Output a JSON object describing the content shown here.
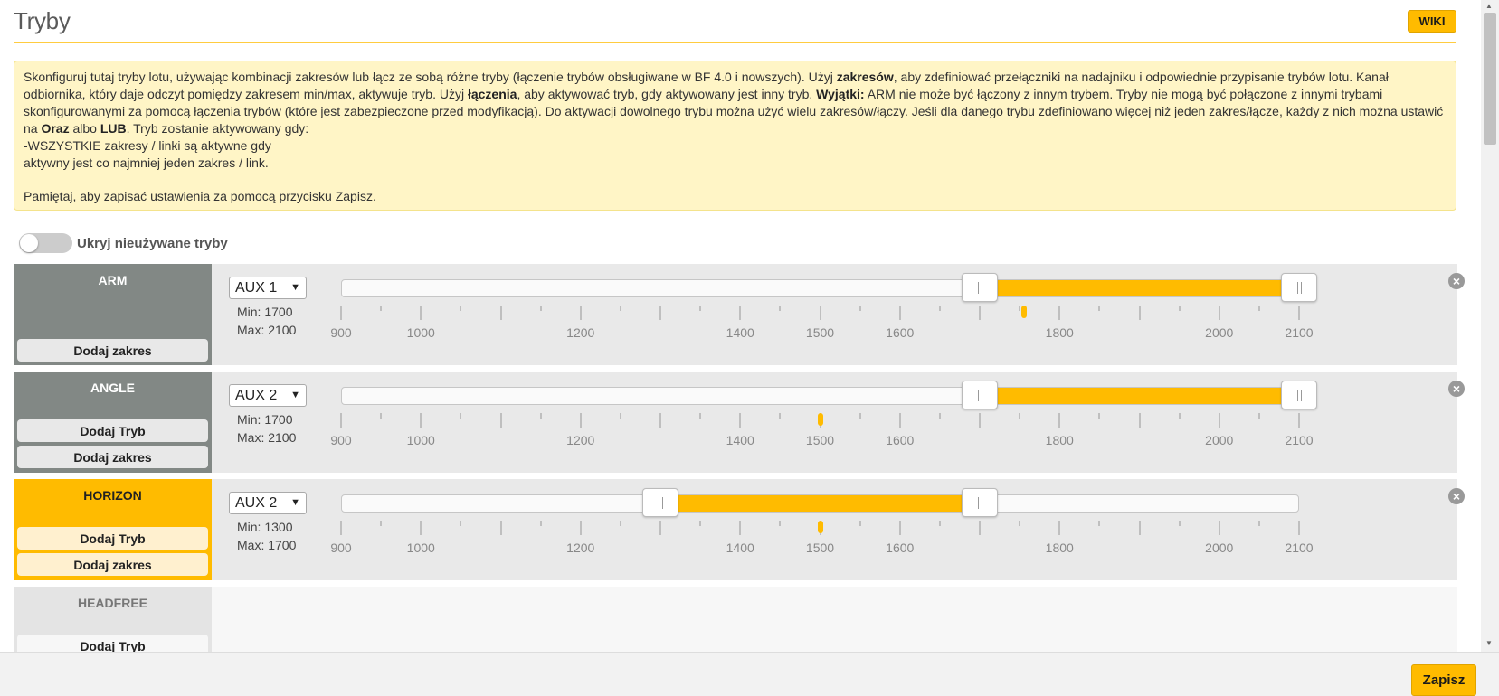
{
  "header": {
    "title": "Tryby",
    "wiki_label": "WIKI"
  },
  "note": {
    "p1": "Skonfiguruj tutaj tryby lotu, używając kombinacji zakresów lub łącz ze sobą różne tryby (łączenie trybów obsługiwane w BF 4.0 i nowszych). Użyj ",
    "b1": "zakresów",
    "p2": ", aby zdefiniować przełączniki na nadajniku i odpowiednie przypisanie trybów lotu. Kanał odbiornika, który daje odczyt pomiędzy zakresem min/max, aktywuje tryb. Użyj ",
    "b2": "łączenia",
    "p3": ", aby aktywować tryb, gdy aktywowany jest inny tryb. ",
    "b3": "Wyjątki:",
    "p4": " ARM nie może być łączony z innym trybem. Tryby nie mogą być połączone z innymi trybami skonfigurowanymi za pomocą łączenia trybów (które jest zabezpieczone przed modyfikacją). Do aktywacji dowolnego trybu można użyć wielu zakresów/łączy. Jeśli dla danego trybu zdefiniowano więcej niż jeden zakres/łącze, każdy z nich można ustawić na ",
    "b4": "Oraz",
    "p5": " albo ",
    "b5": "LUB",
    "p6": ". Tryb zostanie aktywowany gdy:",
    "line2": "-WSZYSTKIE zakresy / linki są aktywne gdy",
    "line3": "aktywny jest co najmniej jeden zakres / link.",
    "line4": "Pamiętaj, aby zapisać ustawienia za pomocą przycisku Zapisz."
  },
  "toggle": {
    "label": "Ukryj nieużywane tryby",
    "on": false
  },
  "scale": {
    "min": 900,
    "max": 2100,
    "labels": [
      "900",
      "1000",
      "1200",
      "1400",
      "1500",
      "1600",
      "1800",
      "2000",
      "2100"
    ]
  },
  "modes": [
    {
      "name": "ARM",
      "add_mode": "",
      "add_range": "Dodaj zakres",
      "aux": "AUX 1",
      "min_text": "Min: 1700",
      "max_text": "Max: 2100",
      "range_min": 1700,
      "range_max": 2100,
      "channel_value": 1755
    },
    {
      "name": "ANGLE",
      "add_mode": "Dodaj Tryb",
      "add_range": "Dodaj zakres",
      "aux": "AUX 2",
      "min_text": "Min: 1700",
      "max_text": "Max: 2100",
      "range_min": 1700,
      "range_max": 2100,
      "channel_value": 1500
    },
    {
      "name": "HORIZON",
      "add_mode": "Dodaj Tryb",
      "add_range": "Dodaj zakres",
      "aux": "AUX 2",
      "min_text": "Min: 1300",
      "max_text": "Max: 1700",
      "range_min": 1300,
      "range_max": 1700,
      "channel_value": 1500
    },
    {
      "name": "HEADFREE",
      "add_mode": "Dodaj Tryb"
    }
  ],
  "footer": {
    "save_label": "Zapisz"
  },
  "colors": {
    "accent": "#ffbb00",
    "mode_inactive": "#828885"
  }
}
